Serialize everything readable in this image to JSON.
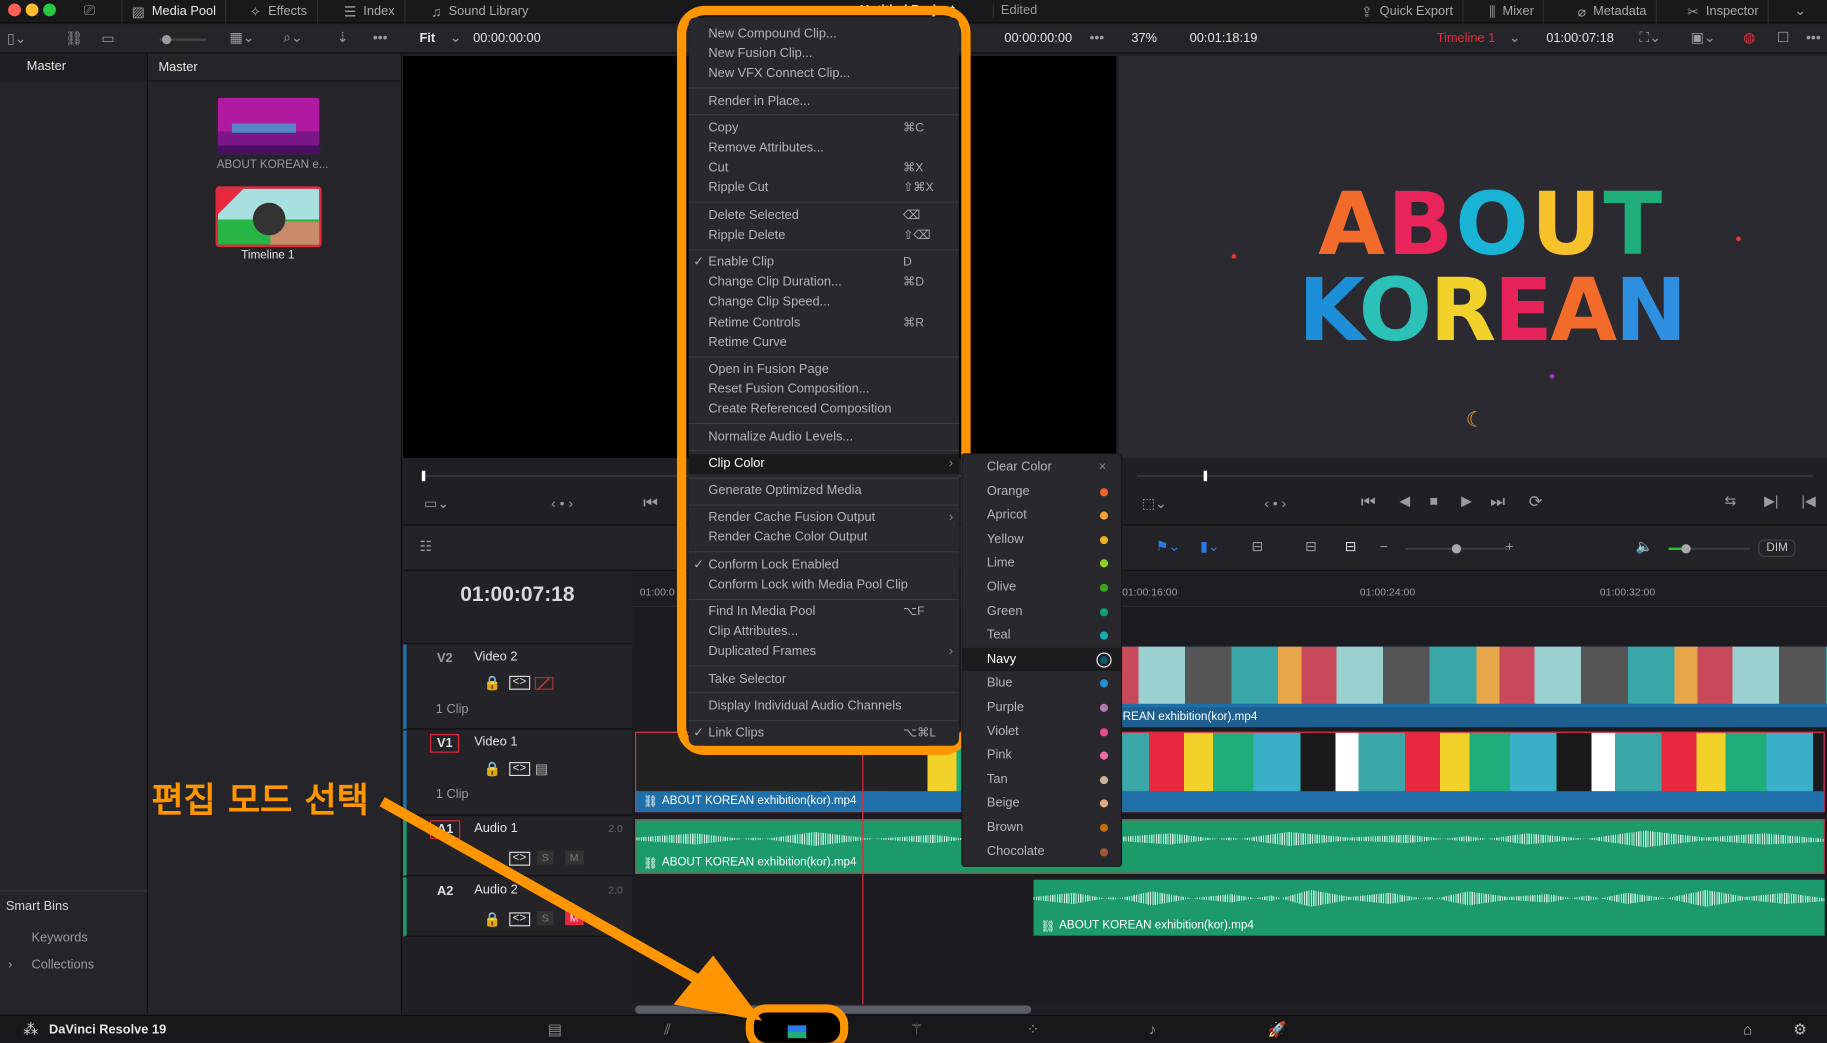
{
  "window": {
    "project_title": "Untitled Project",
    "status": "Edited"
  },
  "top_tabs": [
    {
      "label": "Media Pool",
      "icon": "media-pool-icon",
      "active": true
    },
    {
      "label": "Effects",
      "icon": "effects-wand-icon"
    },
    {
      "label": "Index",
      "icon": "index-list-icon"
    },
    {
      "label": "Sound Library",
      "icon": "sound-library-icon"
    }
  ],
  "right_tabs": [
    {
      "label": "Quick Export",
      "icon": "export-icon"
    },
    {
      "label": "Mixer",
      "icon": "mixer-icon"
    },
    {
      "label": "Metadata",
      "icon": "metadata-icon"
    },
    {
      "label": "Inspector",
      "icon": "inspector-icon"
    }
  ],
  "source_viewer": {
    "zoom": "Fit",
    "timecode_in": "00:00:00:00",
    "timecode_right": "00:00:00:00"
  },
  "program_viewer": {
    "zoom": "37%",
    "duration": "00:01:18:19",
    "timeline_name": "Timeline 1",
    "timecode": "01:00:07:18",
    "title_line1": "ABOUT",
    "title_line2": "KOREAN",
    "letter_colors": [
      "#f36b2b",
      "#e9245a",
      "#19b3d6",
      "#f6c12a",
      "#1fae7a",
      "#1c8fd8",
      "#2bc0b8",
      "#f2d12a",
      "#e6245a",
      "#f36b2b",
      "#2e8fe0",
      "#a03cc0"
    ]
  },
  "bins": {
    "left_header": "Master",
    "pool_header": "Master",
    "smart_bins": "Smart Bins",
    "keywords": "Keywords",
    "collections": "Collections"
  },
  "media_items": [
    {
      "label": "ABOUT KOREAN e..."
    },
    {
      "label": "Timeline 1",
      "selected": true
    }
  ],
  "timeline": {
    "timecode": "01:00:07:18",
    "ruler": [
      "01:00:0",
      "01:00:16:00",
      "01:00:24:00",
      "01:00:32:00"
    ],
    "tracks": [
      {
        "id": "V2",
        "name": "Video 2",
        "clips": "1 Clip"
      },
      {
        "id": "V1",
        "name": "Video 1",
        "clips": "1 Clip"
      },
      {
        "id": "A1",
        "name": "Audio 1",
        "channels": "2.0",
        "solo": "S",
        "mute": "M"
      },
      {
        "id": "A2",
        "name": "Audio 2",
        "channels": "2.0",
        "solo": "S",
        "mute": "M"
      }
    ],
    "clip_name": "ABOUT KOREAN exhibition(kor).mp4",
    "dim_label": "DIM"
  },
  "context_menu": {
    "groups": [
      [
        {
          "label": "New Compound Clip..."
        },
        {
          "label": "New Fusion Clip..."
        },
        {
          "label": "New VFX Connect Clip..."
        }
      ],
      [
        {
          "label": "Render in Place..."
        }
      ],
      [
        {
          "label": "Copy",
          "shortcut": "⌘C"
        },
        {
          "label": "Remove Attributes..."
        },
        {
          "label": "Cut",
          "shortcut": "⌘X"
        },
        {
          "label": "Ripple Cut",
          "shortcut": "⇧⌘X"
        }
      ],
      [
        {
          "label": "Delete Selected",
          "shortcut": "⌫"
        },
        {
          "label": "Ripple Delete",
          "shortcut": "⇧⌫"
        }
      ],
      [
        {
          "label": "Enable Clip",
          "shortcut": "D",
          "checked": true
        },
        {
          "label": "Change Clip Duration...",
          "shortcut": "⌘D"
        },
        {
          "label": "Change Clip Speed..."
        },
        {
          "label": "Retime Controls",
          "shortcut": "⌘R"
        },
        {
          "label": "Retime Curve"
        }
      ],
      [
        {
          "label": "Open in Fusion Page"
        },
        {
          "label": "Reset Fusion Composition..."
        },
        {
          "label": "Create Referenced Composition"
        }
      ],
      [
        {
          "label": "Normalize Audio Levels..."
        }
      ],
      [
        {
          "label": "Clip Color",
          "submenu": true,
          "highlighted": true
        }
      ],
      [
        {
          "label": "Generate Optimized Media"
        }
      ],
      [
        {
          "label": "Render Cache Fusion Output",
          "submenu": true
        },
        {
          "label": "Render Cache Color Output"
        }
      ],
      [
        {
          "label": "Conform Lock Enabled",
          "checked": true
        },
        {
          "label": "Conform Lock with Media Pool Clip"
        }
      ],
      [
        {
          "label": "Find In Media Pool",
          "shortcut": "⌥F"
        },
        {
          "label": "Clip Attributes..."
        },
        {
          "label": "Duplicated Frames",
          "submenu": true
        }
      ],
      [
        {
          "label": "Take Selector"
        }
      ],
      [
        {
          "label": "Display Individual Audio Channels"
        }
      ],
      [
        {
          "label": "Link Clips",
          "shortcut": "⌥⌘L",
          "checked": true
        }
      ]
    ]
  },
  "clip_color_menu": [
    {
      "label": "Clear Color",
      "color": null
    },
    {
      "label": "Orange",
      "color": "#f26522"
    },
    {
      "label": "Apricot",
      "color": "#f7a23a"
    },
    {
      "label": "Yellow",
      "color": "#e8b21e"
    },
    {
      "label": "Lime",
      "color": "#8fd11e"
    },
    {
      "label": "Olive",
      "color": "#3aa61e"
    },
    {
      "label": "Green",
      "color": "#13a07a"
    },
    {
      "label": "Teal",
      "color": "#0fb0b4"
    },
    {
      "label": "Navy",
      "color": "#0b5470",
      "selected": true
    },
    {
      "label": "Blue",
      "color": "#2a8fcf"
    },
    {
      "label": "Purple",
      "color": "#b07ab0"
    },
    {
      "label": "Violet",
      "color": "#e84a92"
    },
    {
      "label": "Pink",
      "color": "#f06aa8"
    },
    {
      "label": "Tan",
      "color": "#c8b49a"
    },
    {
      "label": "Beige",
      "color": "#dca882"
    },
    {
      "label": "Brown",
      "color": "#c06a14"
    },
    {
      "label": "Chocolate",
      "color": "#a05a3a"
    }
  ],
  "annotation": {
    "text": "편집 모드 선택",
    "color": "#ff9500"
  },
  "footer": {
    "app_name": "DaVinci Resolve 19",
    "pages": [
      "media-page-icon",
      "cut-page-icon",
      "edit-page-icon",
      "fusion-page-icon",
      "color-page-icon",
      "fairlight-page-icon",
      "deliver-page-icon"
    ],
    "active_page": "edit-page-icon"
  }
}
